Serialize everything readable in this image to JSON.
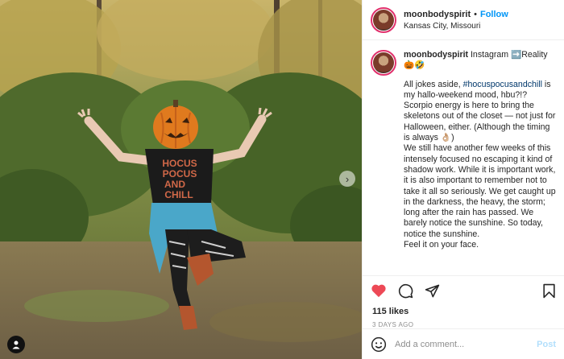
{
  "post": {
    "username": "moonbodyspirit",
    "follow_label": "Follow",
    "separator": "•",
    "location": "Kansas City, Missouri"
  },
  "caption": {
    "username": "moonbodyspirit",
    "line1": " Instagram ➡️Reality 🎃🤣",
    "p1_pre": "All jokes aside, ",
    "hashtag": "#hocuspocusandchill",
    "p1_post": " is my hallo-weekend mood, hbu?!? Scorpio energy is here to bring the skeletons out of the closet — not just for Halloween, either. (Although the timing is always 👌🏼)",
    "p2": "We still have another few weeks of this intensely focused no escaping it kind of shadow work. While it is important work, it is also important to remember not to take it all so seriously. We get caught up in the darkness, the heavy, the storm; long after the rain has passed. We barely notice the sunshine. So today, notice the sunshine.",
    "p3": "Feel it on your face."
  },
  "photo": {
    "shirt_text": [
      "HOCUS",
      "POCUS",
      "AND",
      "CHILL"
    ]
  },
  "stats": {
    "likes": "115 likes",
    "date": "3 DAYS AGO"
  },
  "comment": {
    "placeholder": "Add a comment...",
    "post_label": "Post"
  },
  "icons": {
    "like": "heart-icon",
    "comment": "comment-icon",
    "share": "share-icon",
    "save": "bookmark-icon",
    "emoji": "emoji-icon",
    "next": "chevron-right-icon",
    "tag": "user-tag-icon"
  },
  "colors": {
    "like_red": "#ed4956",
    "follow_blue": "#0095f6",
    "post_disabled": "#b2dffc",
    "hashtag": "#00376b"
  }
}
